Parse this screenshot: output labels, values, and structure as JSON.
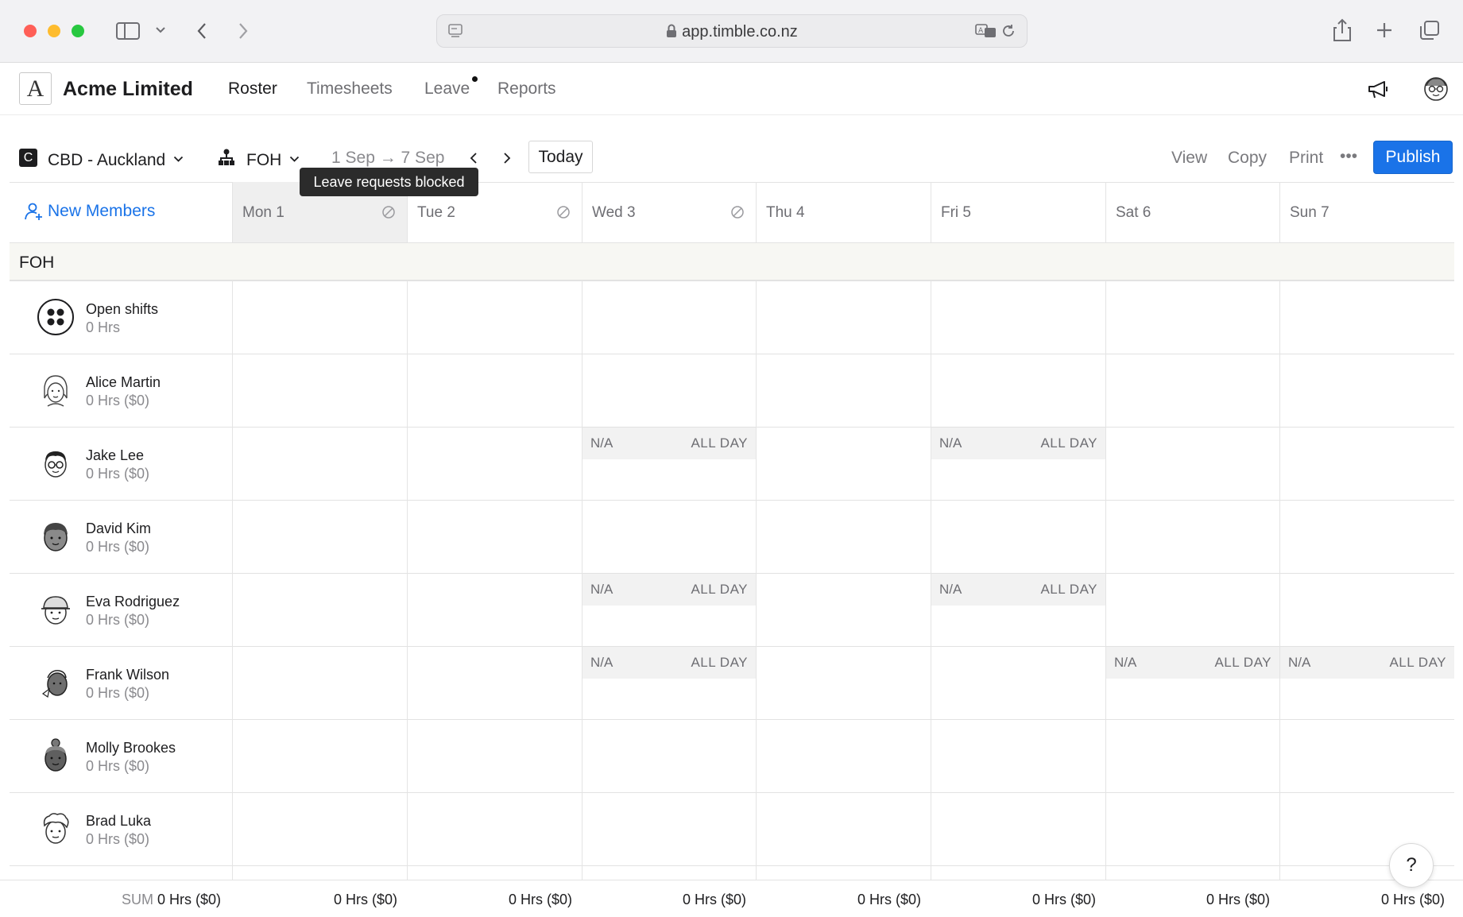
{
  "browser": {
    "url": "app.timble.co.nz"
  },
  "app": {
    "company": "Acme Limited",
    "logo_letter": "A",
    "nav": [
      {
        "label": "Roster",
        "active": true
      },
      {
        "label": "Timesheets",
        "active": false
      },
      {
        "label": "Leave",
        "active": false,
        "has_dot": true
      },
      {
        "label": "Reports",
        "active": false
      }
    ]
  },
  "toolbar": {
    "location_badge": "C",
    "location": "CBD - Auckland",
    "department": "FOH",
    "date_range": "1 Sep → 7 Sep",
    "today": "Today",
    "view": "View",
    "copy": "Copy",
    "print": "Print",
    "more": "•••",
    "publish": "Publish",
    "tooltip": "Leave requests blocked"
  },
  "roster": {
    "new_members": "New Members",
    "days": [
      {
        "label": "Mon 1",
        "blocked": true,
        "highlight": true
      },
      {
        "label": "Tue 2",
        "blocked": true,
        "highlight": false
      },
      {
        "label": "Wed 3",
        "blocked": true,
        "highlight": false
      },
      {
        "label": "Thu 4",
        "blocked": false,
        "highlight": false
      },
      {
        "label": "Fri 5",
        "blocked": false,
        "highlight": false
      },
      {
        "label": "Sat 6",
        "blocked": false,
        "highlight": false
      },
      {
        "label": "Sun 7",
        "blocked": false,
        "highlight": false
      }
    ],
    "section": "FOH",
    "members": [
      {
        "name": "Open shifts",
        "hours": "0 Hrs",
        "avatar": "open-shifts-icon",
        "na": []
      },
      {
        "name": "Alice Martin",
        "hours": "0 Hrs ($0)",
        "avatar": "avatar-alice",
        "na": []
      },
      {
        "name": "Jake Lee",
        "hours": "0 Hrs ($0)",
        "avatar": "avatar-jake",
        "na": [
          2,
          4
        ]
      },
      {
        "name": "David Kim",
        "hours": "0 Hrs ($0)",
        "avatar": "avatar-david",
        "na": []
      },
      {
        "name": "Eva Rodriguez",
        "hours": "0 Hrs ($0)",
        "avatar": "avatar-eva",
        "na": [
          2,
          4
        ]
      },
      {
        "name": "Frank Wilson",
        "hours": "0 Hrs ($0)",
        "avatar": "avatar-frank",
        "na": [
          2,
          5,
          6
        ]
      },
      {
        "name": "Molly Brookes",
        "hours": "0 Hrs ($0)",
        "avatar": "avatar-molly",
        "na": []
      },
      {
        "name": "Brad Luka",
        "hours": "0 Hrs ($0)",
        "avatar": "avatar-brad",
        "na": []
      }
    ],
    "na_label": "N/A",
    "all_day_label": "ALL DAY"
  },
  "footer": {
    "sum_label": "SUM",
    "total": "0 Hrs ($0)",
    "day_totals": [
      "0 Hrs ($0)",
      "0 Hrs ($0)",
      "0 Hrs ($0)",
      "0 Hrs ($0)",
      "0 Hrs ($0)",
      "0 Hrs ($0)",
      "0 Hrs ($0)"
    ]
  },
  "help": "?"
}
